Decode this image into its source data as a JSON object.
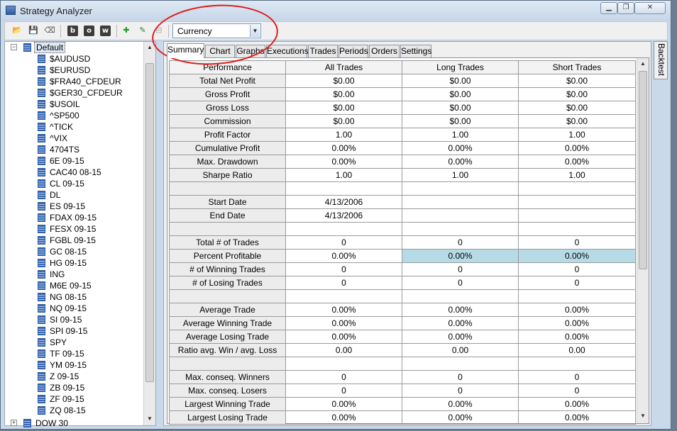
{
  "window": {
    "title": "Strategy Analyzer",
    "controls": [
      "minimize",
      "restore",
      "close"
    ]
  },
  "toolbar": {
    "buttons": [
      "open-folder-icon",
      "save-icon",
      "clear-icon",
      "b-icon",
      "o-icon",
      "w-icon",
      "add-icon",
      "edit-icon",
      "remove-icon"
    ],
    "letters": {
      "b": "b",
      "o": "o",
      "w": "w"
    },
    "currency": {
      "value": "Currency"
    }
  },
  "tree": {
    "root": "Default",
    "items": [
      "$AUDUSD",
      "$EURUSD",
      "$FRA40_CFDEUR",
      "$GER30_CFDEUR",
      "$USOIL",
      "^SP500",
      "^TICK",
      "^VIX",
      "4704TS",
      "6E 09-15",
      "CAC40 08-15",
      "CL 09-15",
      "DL",
      "ES 09-15",
      "FDAX 09-15",
      "FESX 09-15",
      "FGBL 09-15",
      "GC 08-15",
      "HG 09-15",
      "ING",
      "M6E 09-15",
      "NG 08-15",
      "NQ 09-15",
      "SI 09-15",
      "SPI 09-15",
      "SPY",
      "TF 09-15",
      "YM 09-15",
      "Z 09-15",
      "ZB 09-15",
      "ZF 09-15",
      "ZQ 08-15"
    ],
    "next_group": "DOW 30"
  },
  "tabs": [
    "Summary",
    "Chart",
    "Graphs",
    "Executions",
    "Trades",
    "Periods",
    "Orders",
    "Settings"
  ],
  "side_tab": "Backtest",
  "table": {
    "headers": [
      "Performance",
      "All Trades",
      "Long Trades",
      "Short Trades"
    ],
    "rows": [
      [
        "Total Net Profit",
        "$0.00",
        "$0.00",
        "$0.00"
      ],
      [
        "Gross Profit",
        "$0.00",
        "$0.00",
        "$0.00"
      ],
      [
        "Gross Loss",
        "$0.00",
        "$0.00",
        "$0.00"
      ],
      [
        "Commission",
        "$0.00",
        "$0.00",
        "$0.00"
      ],
      [
        "Profit Factor",
        "1.00",
        "1.00",
        "1.00"
      ],
      [
        "Cumulative Profit",
        "0.00%",
        "0.00%",
        "0.00%"
      ],
      [
        "Max. Drawdown",
        "0.00%",
        "0.00%",
        "0.00%"
      ],
      [
        "Sharpe Ratio",
        "1.00",
        "1.00",
        "1.00"
      ],
      [
        "",
        "",
        "",
        ""
      ],
      [
        "Start Date",
        "4/13/2006",
        "",
        ""
      ],
      [
        "End Date",
        "4/13/2006",
        "",
        ""
      ],
      [
        "",
        "",
        "",
        ""
      ],
      [
        "Total # of Trades",
        "0",
        "0",
        "0"
      ],
      [
        "Percent Profitable",
        "0.00%",
        "0.00%",
        "0.00%"
      ],
      [
        "# of Winning Trades",
        "0",
        "0",
        "0"
      ],
      [
        "# of Losing Trades",
        "0",
        "0",
        "0"
      ],
      [
        "",
        "",
        "",
        ""
      ],
      [
        "Average Trade",
        "0.00%",
        "0.00%",
        "0.00%"
      ],
      [
        "Average Winning Trade",
        "0.00%",
        "0.00%",
        "0.00%"
      ],
      [
        "Average Losing Trade",
        "0.00%",
        "0.00%",
        "0.00%"
      ],
      [
        "Ratio avg. Win / avg. Loss",
        "0.00",
        "0.00",
        "0.00"
      ],
      [
        "",
        "",
        "",
        ""
      ],
      [
        "Max. conseq. Winners",
        "0",
        "0",
        "0"
      ],
      [
        "Max. conseq. Losers",
        "0",
        "0",
        "0"
      ],
      [
        "Largest Winning Trade",
        "0.00%",
        "0.00%",
        "0.00%"
      ],
      [
        "Largest Losing Trade",
        "0.00%",
        "0.00%",
        "0.00%"
      ]
    ],
    "highlighted_row": "Percent Profitable"
  },
  "colors": {
    "highlight": "#b7dbe6",
    "annotation": "#e01a1a",
    "window_frame": "#c9d9ea"
  }
}
